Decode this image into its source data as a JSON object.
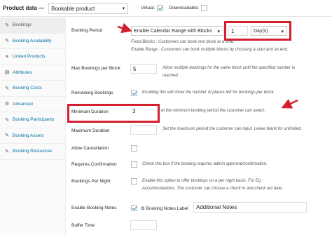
{
  "header": {
    "title": "Product data —",
    "product_type": "Bookable product",
    "virtual_label": "Virtual:",
    "downloadable_label": "Downloadable:",
    "virtual_checked": true,
    "downloadable_checked": false
  },
  "sidebar": {
    "items": [
      {
        "label": "Bookings",
        "icon": "wrench-icon",
        "active": true
      },
      {
        "label": "Booking Availability",
        "icon": "wrench-icon"
      },
      {
        "label": "Linked Products",
        "icon": "link-icon"
      },
      {
        "label": "Attributes",
        "icon": "list-icon"
      },
      {
        "label": "Booking Costs",
        "icon": "wrench-icon"
      },
      {
        "label": "Advanced",
        "icon": "gear-icon"
      },
      {
        "label": "Booking Participants",
        "icon": "wrench-icon"
      },
      {
        "label": "Booking Assets",
        "icon": "wrench-icon"
      },
      {
        "label": "Booking Resources",
        "icon": "wrench-icon"
      }
    ]
  },
  "fields": {
    "booking_period": {
      "label": "Booking Period",
      "select": "Enable Calendar Range with Blocks",
      "block_value": "1",
      "unit": "Day(s)",
      "desc1": "Fixed Blocks : Customers can book one block at a time.",
      "desc2": "Enable Range : Customers can book multiple blocks by choosing a start and an end."
    },
    "max_bookings": {
      "label": "Max Bookings per Block",
      "value": "5",
      "desc1": "Allow multiple bookings for the same block until the specified number is",
      "desc2": "reached."
    },
    "remaining": {
      "label": "Remaining Bookings",
      "desc": "Enabling this will show the number of places left for bookings per block."
    },
    "min_duration": {
      "label": "Minimum Duration",
      "value": "3",
      "desc": "et the minimum booking period the customer can select."
    },
    "max_duration": {
      "label": "Maximum Duration",
      "value": "",
      "desc": "Set the maximum period the customer can input. Leave blank for unlimited."
    },
    "allow_cancellation": {
      "label": "Allow Cancellation"
    },
    "requires_confirmation": {
      "label": "Requires Confirmation",
      "desc": "Check this box if the booking requires admin approval/confirmation."
    },
    "bookings_per_night": {
      "label": "Bookings Per Night",
      "desc1": "Enable this option to offer bookings on a per night basis. For Eg :",
      "desc2": "Accommodations. The customer can choose a check in and check out date."
    },
    "enable_notes": {
      "label": "Enable Booking Notes",
      "notes_label": "Booking Notes Label",
      "notes_value": "Additional Notes"
    },
    "buffer_time": {
      "label": "Buffer Time"
    }
  },
  "colors": {
    "highlight": "#d2202f",
    "link": "#0073aa",
    "check": "#1e8cbe"
  }
}
